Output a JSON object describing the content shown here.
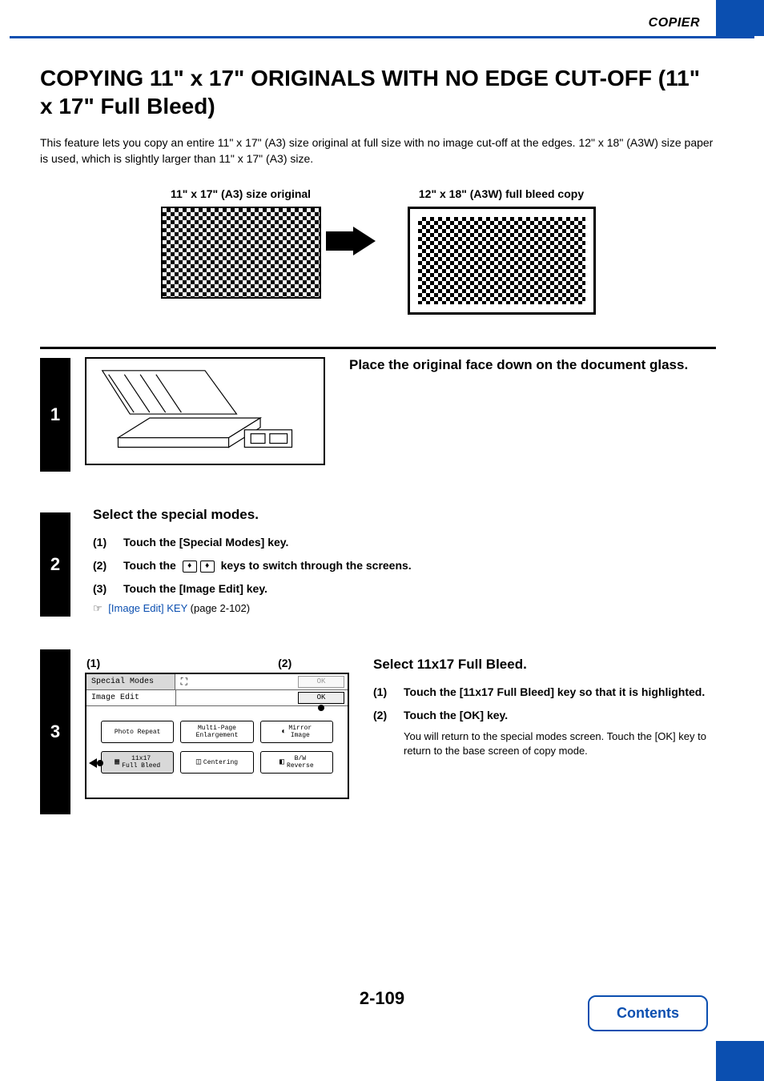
{
  "header": {
    "section": "COPIER"
  },
  "title": "COPYING 11\" x 17\" ORIGINALS WITH NO EDGE CUT-OFF (11\" x 17\" Full Bleed)",
  "intro": "This feature lets you copy an entire 11\" x 17\" (A3) size original at full size with no image cut-off at the edges. 12\" x 18\" (A3W) size paper is used, which is slightly larger than 11\" x 17\" (A3) size.",
  "diagram": {
    "left_label": "11\" x 17\" (A3) size original",
    "right_label": "12\" x 18\" (A3W) full bleed copy"
  },
  "steps": {
    "s1": {
      "num": "1",
      "title": "Place the original face down on the document glass."
    },
    "s2": {
      "num": "2",
      "title": "Select the special modes.",
      "sub1_num": "(1)",
      "sub1": "Touch the [Special Modes] key.",
      "sub2_num": "(2)",
      "sub2a": "Touch the",
      "sub2b": "keys to switch through the screens.",
      "sub3_num": "(3)",
      "sub3": "Touch the [Image Edit] key.",
      "ref_link": "[Image Edit] KEY",
      "ref_tail": " (page 2-102)"
    },
    "s3": {
      "num": "3",
      "callout1": "(1)",
      "callout2": "(2)",
      "title": "Select 11x17 Full Bleed.",
      "sub1_num": "(1)",
      "sub1": "Touch the [11x17 Full Bleed] key so that it is highlighted.",
      "sub2_num": "(2)",
      "sub2": "Touch the [OK] key.",
      "sub2_desc": "You will return to the special modes screen. Touch the [OK] key to return to the base screen of copy mode."
    }
  },
  "panel": {
    "bar1": "Special Modes",
    "bar2": "Image Edit",
    "ok": "OK",
    "btn_photo_repeat": "Photo Repeat",
    "btn_multi_page": "Multi-Page\nEnlargement",
    "btn_mirror": "Mirror\nImage",
    "btn_full_bleed": "11x17\nFull Bleed",
    "btn_centering": "Centering",
    "btn_bw": "B/W\nReverse"
  },
  "page_number": "2-109",
  "contents_label": "Contents"
}
